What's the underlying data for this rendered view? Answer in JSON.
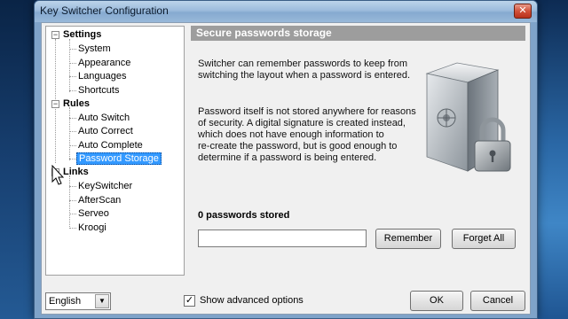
{
  "window": {
    "title": "Key Switcher Configuration",
    "close_glyph": "✕"
  },
  "tree": {
    "settings": {
      "label": "Settings",
      "expander": "−",
      "children": [
        "System",
        "Appearance",
        "Languages",
        "Shortcuts"
      ]
    },
    "rules": {
      "label": "Rules",
      "expander": "−",
      "children": [
        "Auto Switch",
        "Auto Correct",
        "Auto Complete",
        "Password Storage"
      ]
    },
    "links": {
      "label": "Links",
      "expander": "−",
      "children": [
        "KeySwitcher",
        "AfterScan",
        "Serveo",
        "Kroogi"
      ]
    },
    "selected": "Password Storage"
  },
  "content": {
    "header": "Secure passwords storage",
    "para1_lines": [
      "Switcher can remember passwords to keep from",
      "switching the layout when a password is entered."
    ],
    "para2_lines": [
      "Password itself is not stored anywhere for reasons",
      "of security. A digital signature is created instead,",
      "which does not have enough information to",
      "re-create the password, but is good enough to",
      "determine if a password is being entered."
    ],
    "count_label": "0 passwords stored",
    "password_value": "",
    "remember_label": "Remember",
    "forget_label": "Forget All"
  },
  "bottom": {
    "language": "English",
    "dropdown_glyph": "▼",
    "advanced_checked_glyph": "✓",
    "advanced_label": "Show advanced options",
    "ok_label": "OK",
    "cancel_label": "Cancel"
  },
  "icons": {
    "vault": "secure-storage-icon",
    "cursor": "mouse-pointer-icon"
  }
}
